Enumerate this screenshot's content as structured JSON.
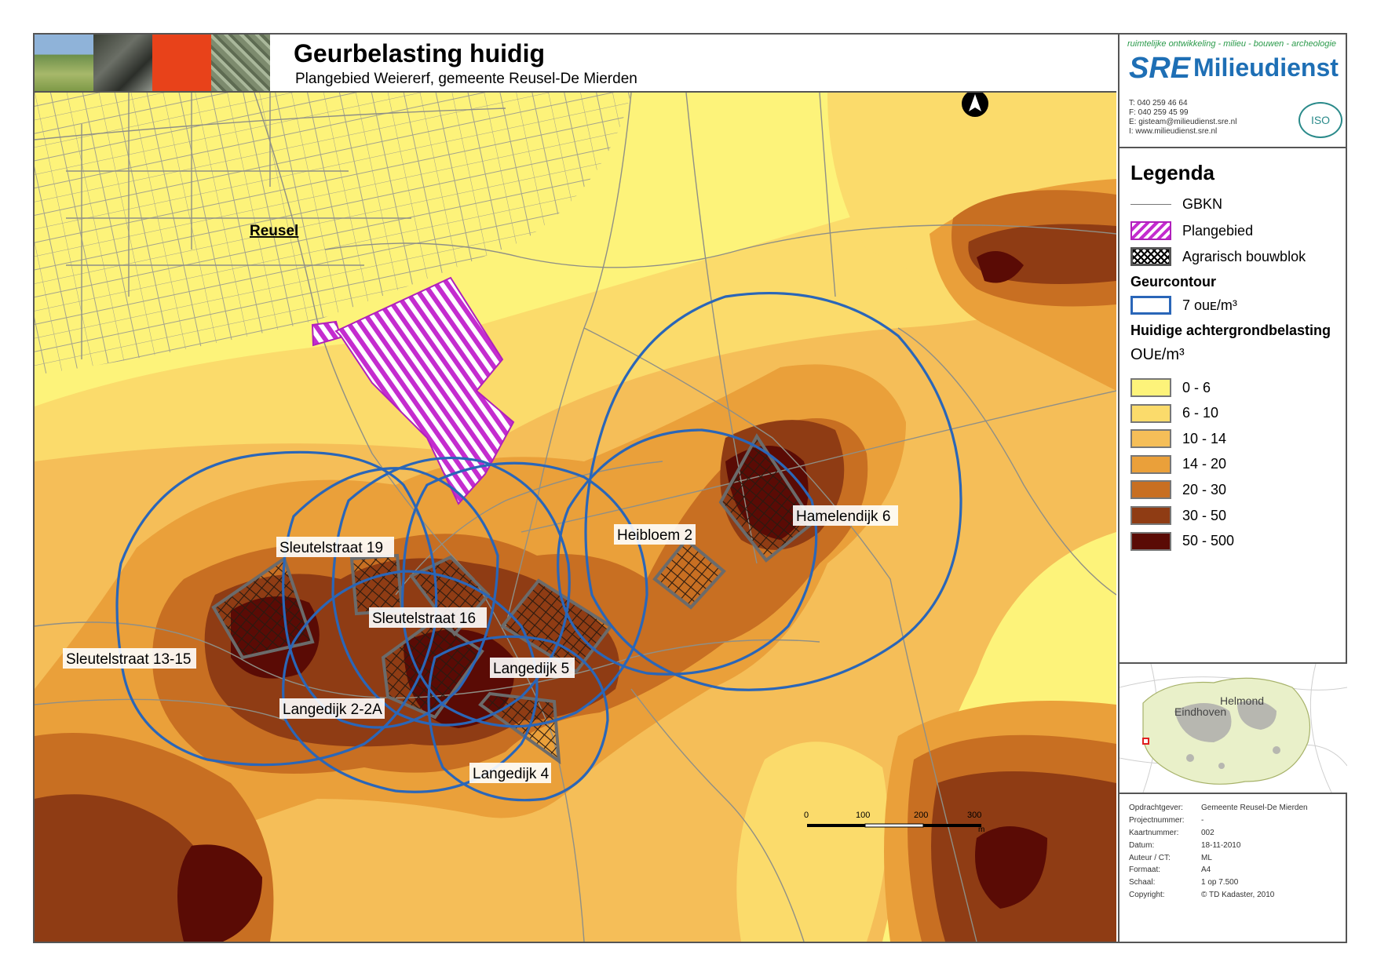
{
  "header": {
    "title": "Geurbelasting huidig",
    "subtitle": "Plangebied Weiererf, gemeente Reusel-De Mierden"
  },
  "brand": {
    "tagline": "ruimtelijke ontwikkeling - milieu - bouwen - archeologie",
    "logo_mark": "SRE",
    "logo_name": "Milieudienst",
    "contact": [
      {
        "key": "T:",
        "value": "040 259 46 64"
      },
      {
        "key": "F:",
        "value": "040 259 45 99"
      },
      {
        "key": "E:",
        "value": "gisteam@milieudienst.sre.nl"
      },
      {
        "key": "I:",
        "value": "www.milieudienst.sre.nl"
      }
    ],
    "iso_label": "ISO",
    "colors": {
      "logo_blue": "#1e6fb5",
      "tagline_green": "#2a9a4a"
    }
  },
  "legend": {
    "title": "Legenda",
    "gbkn": "GBKN",
    "plangebied": "Plangebied",
    "bouwblok": "Agrarisch bouwblok",
    "geurcontour_head": "Geurcontour",
    "geurcontour_label": "7 ouᴇ/m³",
    "background_head": "Huidige achtergrondbelasting",
    "unit": "OUᴇ/m³",
    "classes": [
      {
        "label": "0 - 6",
        "color": "#fdf37a"
      },
      {
        "label": "6 - 10",
        "color": "#fbdb6b"
      },
      {
        "label": "10 - 14",
        "color": "#f5be58"
      },
      {
        "label": "14 - 20",
        "color": "#eaa03a"
      },
      {
        "label": "20 - 30",
        "color": "#c86f22"
      },
      {
        "label": "30 - 50",
        "color": "#8f3c14"
      },
      {
        "label": "50 - 500",
        "color": "#5a0b05"
      }
    ]
  },
  "map": {
    "place_label": "Reusel",
    "farm_labels": {
      "sleutelstraat19": "Sleutelstraat 19",
      "sleutelstraat16": "Sleutelstraat 16",
      "sleutelstraat1315": "Sleutelstraat 13-15",
      "langedijk22a": "Langedijk 2-2A",
      "langedijk5": "Langedijk 5",
      "langedijk4": "Langedijk 4",
      "heibloem2": "Heibloem 2",
      "hamelendijk6": "Hamelendijk 6"
    },
    "scale_ticks": [
      "0",
      "100",
      "200",
      "300"
    ],
    "scale_unit": "m",
    "north_icon": "north-arrow-icon"
  },
  "overview": {
    "city1": "Helmond",
    "city2": "Eindhoven"
  },
  "info": [
    {
      "key": "Opdrachtgever:",
      "value": "Gemeente Reusel-De Mierden"
    },
    {
      "key": "Projectnummer:",
      "value": "-"
    },
    {
      "key": "Kaartnummer:",
      "value": "002"
    },
    {
      "key": "Datum:",
      "value": "18-11-2010"
    },
    {
      "key": "Auteur / CT:",
      "value": "ML"
    },
    {
      "key": "Formaat:",
      "value": "A4"
    },
    {
      "key": "Schaal:",
      "value": "1 op 7.500"
    },
    {
      "key": "Copyright:",
      "value": "© TD Kadaster, 2010"
    }
  ]
}
